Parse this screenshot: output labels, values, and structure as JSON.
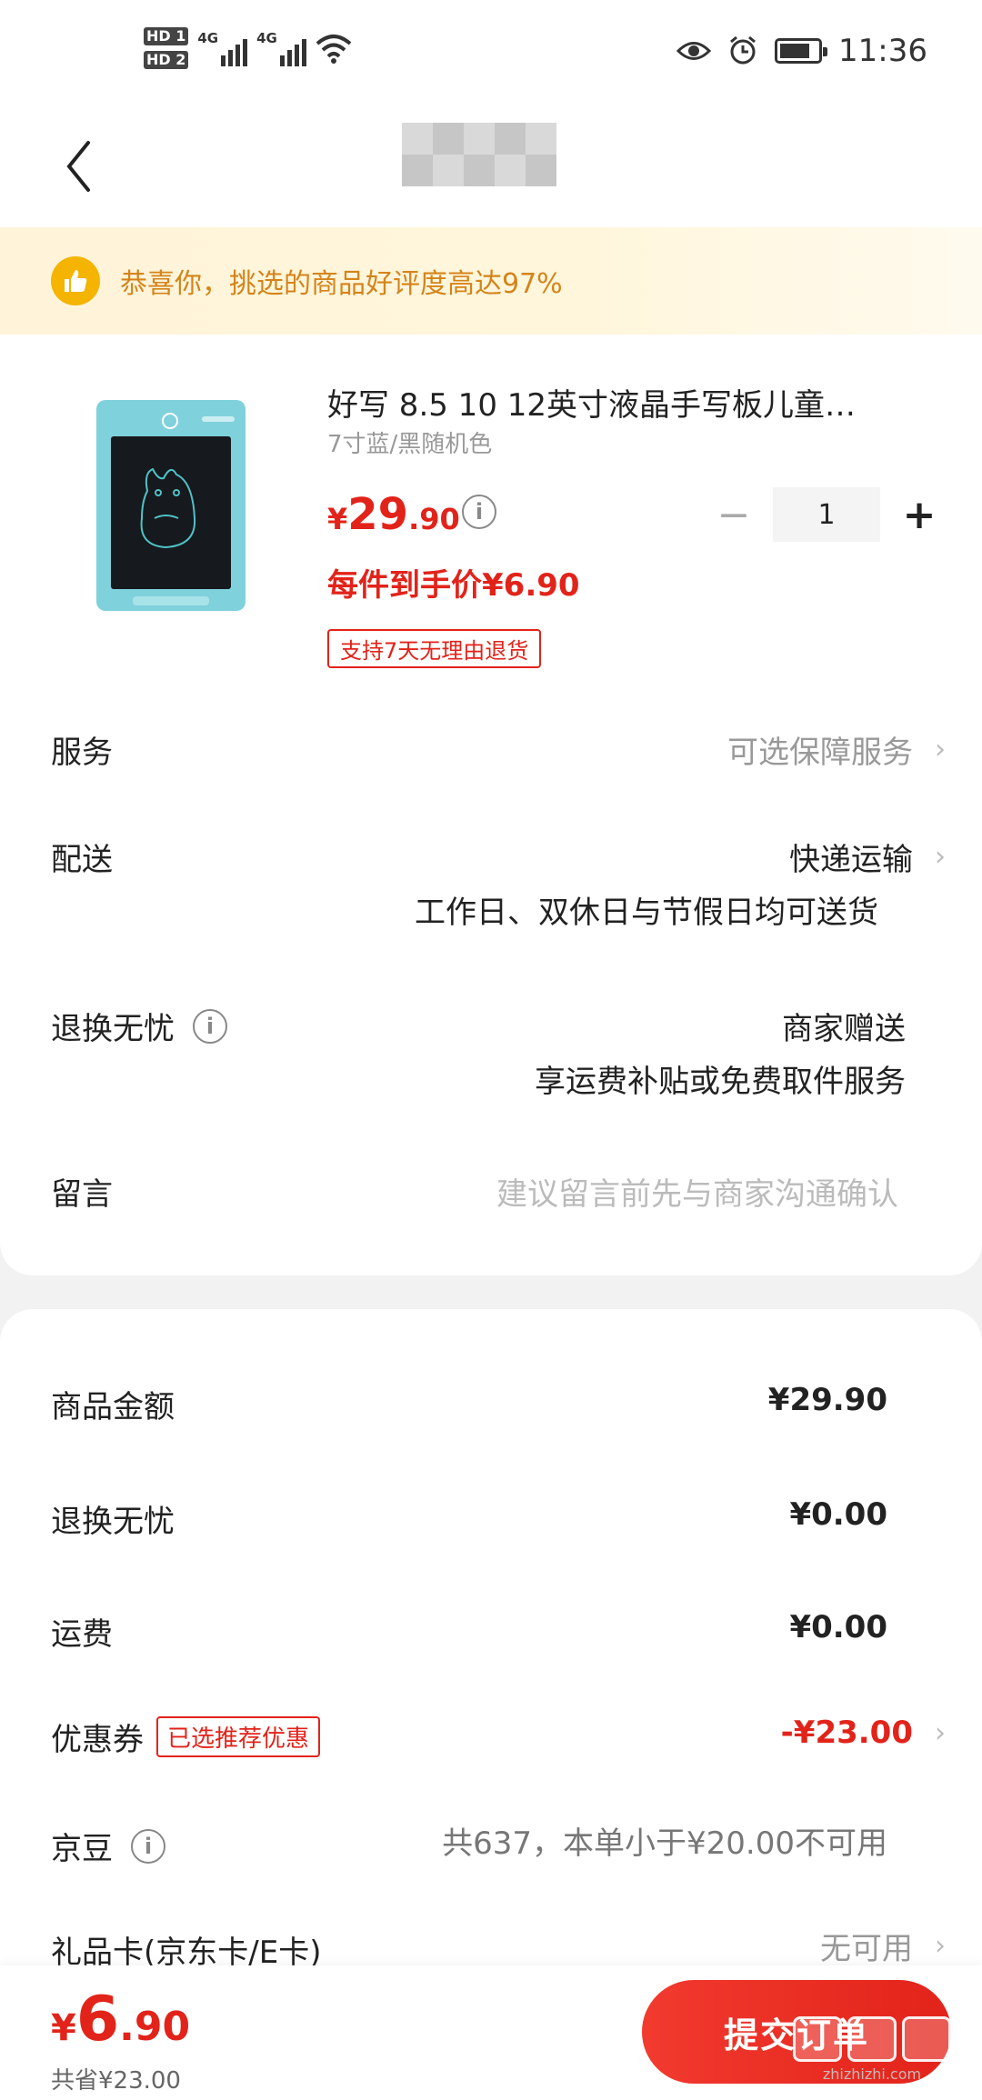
{
  "status_bar": {
    "hd1": "HD 1",
    "hd2": "HD 2",
    "sig1_label": "4G",
    "sig2_label": "4G",
    "time": "11:36"
  },
  "banner": {
    "text": "恭喜你，挑选的商品好评度高达97%"
  },
  "product": {
    "title": "好写 8.5 10 12英寸液晶手写板儿童…",
    "spec": "7寸蓝/黑随机色",
    "price_currency": "¥",
    "price_int": "29",
    "price_dec": ".90",
    "per_item_price": "每件到手价¥6.90",
    "return_tag": "支持7天无理由退货",
    "quantity": "1",
    "minus": "−",
    "plus": "+"
  },
  "rows": {
    "service_label": "服务",
    "service_value": "可选保障服务",
    "delivery_label": "配送",
    "delivery_value": "快递运输",
    "delivery_sub": "工作日、双休日与节假日均可送货",
    "returns_label": "退换无忧",
    "returns_value": "商家赠送",
    "returns_sub": "享运费补贴或免费取件服务",
    "message_label": "留言",
    "message_placeholder": "建议留言前先与商家沟通确认"
  },
  "summary": {
    "goods_label": "商品金额",
    "goods_value": "¥29.90",
    "returns_label": "退换无忧",
    "returns_value": "¥0.00",
    "shipping_label": "运费",
    "shipping_value": "¥0.00",
    "coupon_label": "优惠券",
    "coupon_tag": "已选推荐优惠",
    "coupon_value": "-¥23.00",
    "jingdou_label": "京豆",
    "jingdou_value": "共637，本单小于¥20.00不可用",
    "giftcard_label": "礼品卡(京东卡/E卡)",
    "giftcard_value": "无可用"
  },
  "bottom": {
    "total_currency": "¥",
    "total_int": "6",
    "total_dec": ".90",
    "saved": "共省¥23.00",
    "submit": "提交订单",
    "watermark": "zhizhizhi.com"
  },
  "colors": {
    "accent": "#e2231a",
    "banner_text": "#d4841a"
  }
}
